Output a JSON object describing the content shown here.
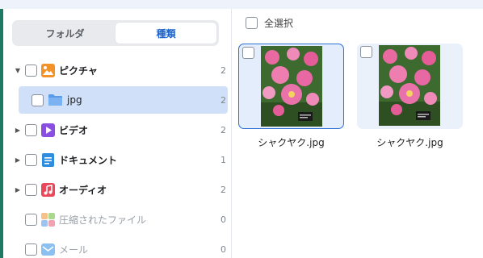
{
  "tabs": {
    "folders_label": "フォルダ",
    "types_label": "種類"
  },
  "tree": [
    {
      "label": "ピクチャ",
      "count": "2",
      "expanded": true,
      "icon": "picture-icon"
    },
    {
      "label": "jpg",
      "count": "2",
      "selected": true,
      "icon": "folder-icon"
    },
    {
      "label": "ビデオ",
      "count": "2",
      "icon": "video-icon"
    },
    {
      "label": "ドキュメント",
      "count": "1",
      "icon": "document-icon"
    },
    {
      "label": "オーディオ",
      "count": "2",
      "icon": "music-icon"
    },
    {
      "label": "圧縮されたファイル",
      "count": "0",
      "dim": true,
      "icon": "archive-icon"
    },
    {
      "label": "メール",
      "count": "0",
      "dim": true,
      "icon": "mail-icon"
    }
  ],
  "main": {
    "select_all_label": "全選択",
    "files": [
      {
        "name": "シャクヤク.jpg"
      },
      {
        "name": "シャクヤク.jpg"
      }
    ]
  },
  "colors": {
    "accent": "#1f62c8",
    "selected_row": "#cfe0f8",
    "sidebar_stripe": "#1f7a64"
  }
}
